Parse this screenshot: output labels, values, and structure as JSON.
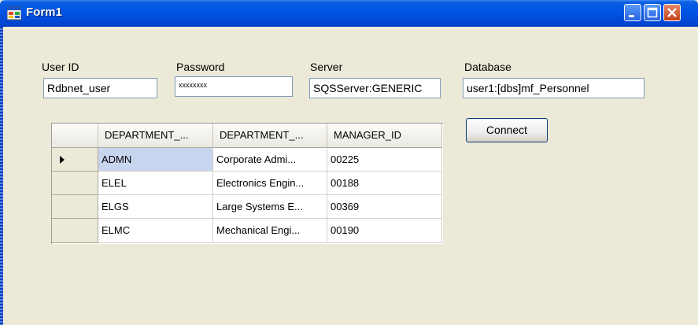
{
  "window": {
    "title": "Form1"
  },
  "form": {
    "userid_label": "User ID",
    "userid_value": "Rdbnet_user",
    "password_label": "Password",
    "password_value": "xxxxxxxx",
    "server_label": "Server",
    "server_value": "SQSServer:GENERIC",
    "database_label": "Database",
    "database_value": "user1:[dbs]mf_Personnel",
    "connect_label": "Connect"
  },
  "grid": {
    "columns": [
      "DEPARTMENT_...",
      "DEPARTMENT_...",
      "MANAGER_ID"
    ],
    "rows": [
      [
        "ADMN",
        "Corporate Admi...",
        "00225"
      ],
      [
        "ELEL",
        "Electronics Engin...",
        "00188"
      ],
      [
        "ELGS",
        "Large Systems E...",
        "00369"
      ],
      [
        "ELMC",
        "Mechanical Engi...",
        "00190"
      ]
    ]
  },
  "colors": {
    "titlebar": "#0055e5",
    "selected_cell": "#c8d5ef",
    "window_bg": "#ece9d8"
  }
}
